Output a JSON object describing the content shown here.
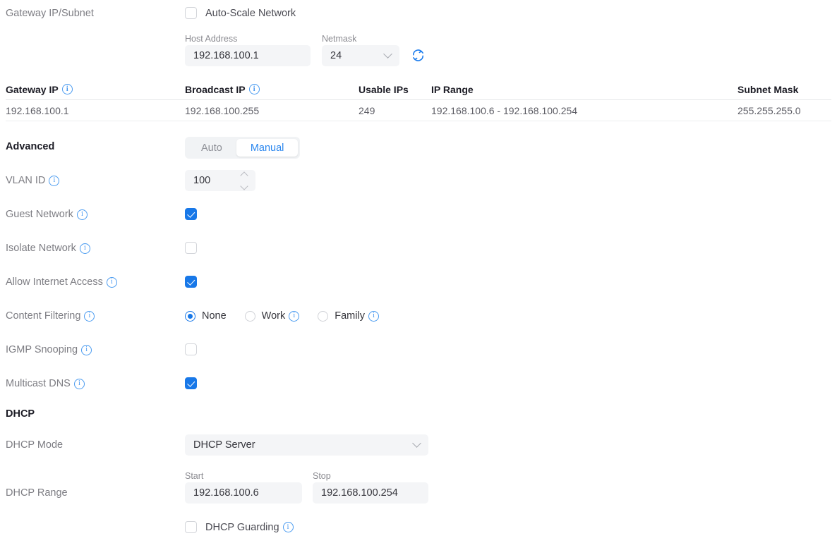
{
  "gateway_section": {
    "label": "Gateway IP/Subnet",
    "auto_scale": {
      "label": "Auto-Scale Network",
      "checked": false
    },
    "host_address": {
      "caption": "Host Address",
      "value": "192.168.100.1"
    },
    "netmask": {
      "caption": "Netmask",
      "value": "24"
    },
    "refresh_icon": "refresh-icon"
  },
  "subnet_table": {
    "columns": [
      {
        "label": "Gateway IP",
        "info": true
      },
      {
        "label": "Broadcast IP",
        "info": true
      },
      {
        "label": "Usable IPs",
        "info": false
      },
      {
        "label": "IP Range",
        "info": false
      },
      {
        "label": "Subnet Mask",
        "info": false
      }
    ],
    "rows": [
      {
        "gateway_ip": "192.168.100.1",
        "broadcast_ip": "192.168.100.255",
        "usable_ips": "249",
        "ip_range": "192.168.100.6 - 192.168.100.254",
        "subnet_mask": "255.255.255.0"
      }
    ]
  },
  "advanced": {
    "heading": "Advanced",
    "mode_toggle": {
      "options": [
        "Auto",
        "Manual"
      ],
      "selected": "Manual"
    },
    "vlan_id": {
      "label": "VLAN ID",
      "value": "100"
    },
    "guest_network": {
      "label": "Guest Network",
      "checked": true
    },
    "isolate_network": {
      "label": "Isolate Network",
      "checked": false
    },
    "allow_internet_access": {
      "label": "Allow Internet Access",
      "checked": true
    },
    "content_filtering": {
      "label": "Content Filtering",
      "options": [
        {
          "label": "None",
          "info": false,
          "selected": true
        },
        {
          "label": "Work",
          "info": true,
          "selected": false
        },
        {
          "label": "Family",
          "info": true,
          "selected": false
        }
      ]
    },
    "igmp_snooping": {
      "label": "IGMP Snooping",
      "checked": false
    },
    "multicast_dns": {
      "label": "Multicast DNS",
      "checked": true
    }
  },
  "dhcp": {
    "heading": "DHCP",
    "dhcp_mode": {
      "label": "DHCP Mode",
      "value": "DHCP Server"
    },
    "dhcp_range": {
      "label": "DHCP Range",
      "start": {
        "caption": "Start",
        "value": "192.168.100.6"
      },
      "stop": {
        "caption": "Stop",
        "value": "192.168.100.254"
      }
    },
    "dhcp_guarding": {
      "label": "DHCP Guarding",
      "checked": false
    }
  },
  "colors": {
    "accent": "#1878e8",
    "accent_light": "#2b87ef",
    "info_outline": "#4a9bf0",
    "field_bg": "#f4f5f7",
    "label": "#7d7d83",
    "text": "#35353c"
  }
}
